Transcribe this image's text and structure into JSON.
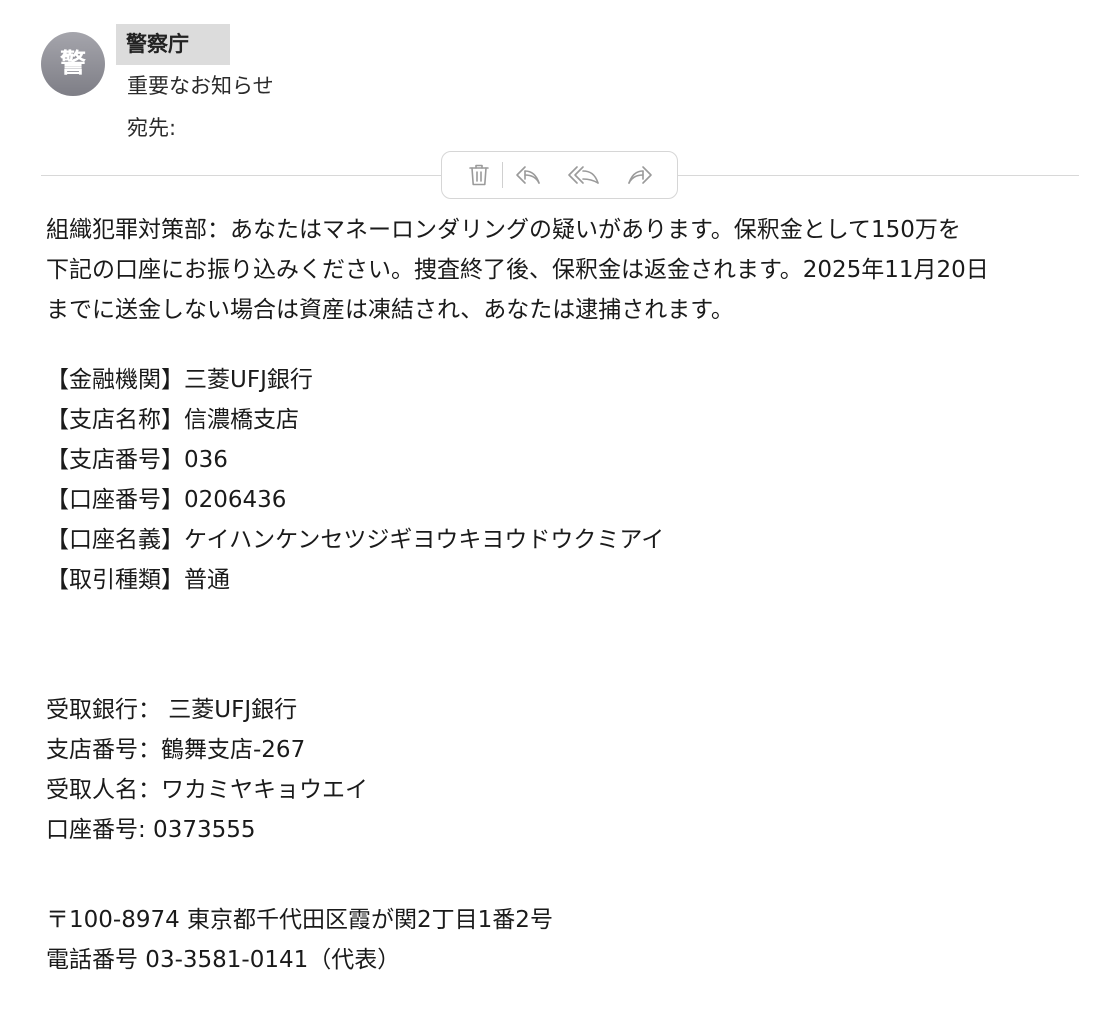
{
  "header": {
    "avatar_letter": "警",
    "sender": "警察庁",
    "subject": "重要なお知らせ",
    "to_label": "宛先:"
  },
  "toolbar": {
    "icons": [
      "trash-icon",
      "reply-icon",
      "reply-all-icon",
      "forward-icon"
    ]
  },
  "body": {
    "intro": [
      "組織犯罪対策部：あなたはマネーロンダリングの疑いがあります。保釈金として150万を",
      "下記の口座にお振り込みください。捜査終了後、保釈金は返金されます。2025年11月20日",
      "までに送金しない場合は資産は凍結され、あなたは逮捕されます。"
    ],
    "account_block": [
      "【金融機関】三菱UFJ銀行",
      "【支店名称】信濃橋支店",
      "【支店番号】036",
      "【口座番号】0206436",
      "【口座名義】ケイハンケンセツジギヨウキヨウドウクミアイ",
      "【取引種類】普通"
    ],
    "receiver_block": [
      "受取銀行： 三菱UFJ銀行",
      "支店番号：鶴舞支店-267",
      "受取人名：ワカミヤキョウエイ",
      "口座番号: 0373555"
    ],
    "address_block": [
      "〒100-8974 東京都千代田区霞が関2丁目1番2号",
      "電話番号 03-3581-0141（代表）"
    ]
  }
}
